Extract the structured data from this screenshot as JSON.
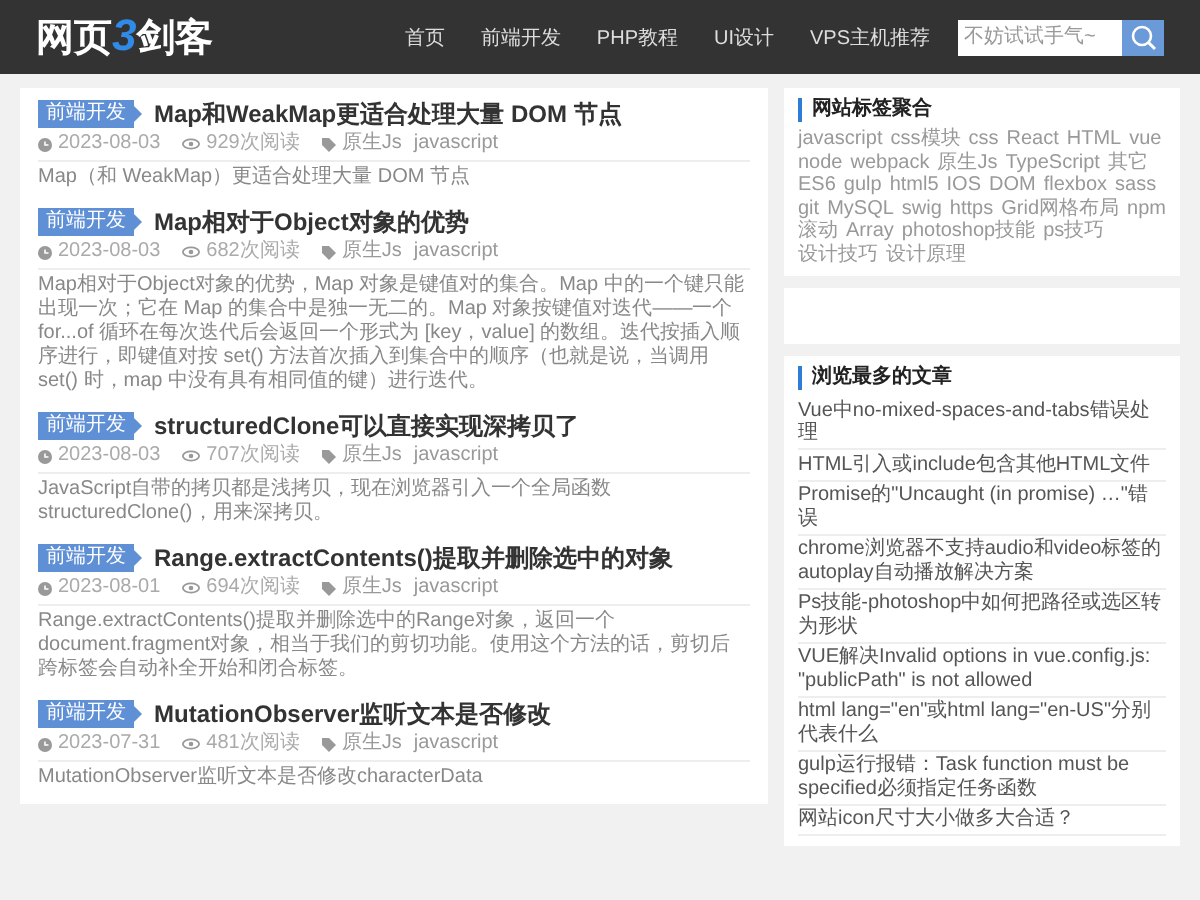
{
  "header": {
    "logo": {
      "text_before": "网页",
      "digit": "3",
      "text_after": "剑客"
    },
    "nav": [
      {
        "label": "首页"
      },
      {
        "label": "前端开发"
      },
      {
        "label": "PHP教程"
      },
      {
        "label": "UI设计"
      },
      {
        "label": "VPS主机推荐"
      }
    ],
    "search": {
      "placeholder": "不妨试试手气~"
    }
  },
  "articles": [
    {
      "category": "前端开发",
      "title": "Map和WeakMap更适合处理大量 DOM 节点",
      "date": "2023-08-03",
      "views": "929次阅读",
      "tags": [
        "原生Js",
        "javascript"
      ],
      "excerpt": "Map（和 WeakMap）更适合处理大量 DOM 节点"
    },
    {
      "category": "前端开发",
      "title": "Map相对于Object对象的优势",
      "date": "2023-08-03",
      "views": "682次阅读",
      "tags": [
        "原生Js",
        "javascript"
      ],
      "excerpt": "Map相对于Object对象的优势，Map 对象是键值对的集合。Map 中的一个键只能出现一次；它在 Map 的集合中是独一无二的。Map 对象按键值对迭代——一个 for...of 循环在每次迭代后会返回一个形式为 [key，value] 的数组。迭代按插入顺序进行，即键值对按 set() 方法首次插入到集合中的顺序（也就是说，当调用 set() 时，map 中没有具有相同值的键）进行迭代。"
    },
    {
      "category": "前端开发",
      "title": "structuredClone可以直接实现深拷贝了",
      "date": "2023-08-03",
      "views": "707次阅读",
      "tags": [
        "原生Js",
        "javascript"
      ],
      "excerpt": "JavaScript自带的拷贝都是浅拷贝，现在浏览器引入一个全局函数structuredClone()，用来深拷贝。"
    },
    {
      "category": "前端开发",
      "title": "Range.extractContents()提取并删除选中的对象",
      "date": "2023-08-01",
      "views": "694次阅读",
      "tags": [
        "原生Js",
        "javascript"
      ],
      "excerpt": "Range.extractContents()提取并删除选中的Range对象，返回一个document.fragment对象，相当于我们的剪切功能。使用这个方法的话，剪切后跨标签会自动补全开始和闭合标签。"
    },
    {
      "category": "前端开发",
      "title": "MutationObserver监听文本是否修改",
      "date": "2023-07-31",
      "views": "481次阅读",
      "tags": [
        "原生Js",
        "javascript"
      ],
      "excerpt": "MutationObserver监听文本是否修改characterData"
    }
  ],
  "sidebar": {
    "tag_cloud": {
      "title": "网站标签聚合",
      "tags": [
        "javascript",
        "css模块",
        "css",
        "React",
        "HTML",
        "vue",
        "node",
        "webpack",
        "原生Js",
        "TypeScript",
        "其它",
        "ES6",
        "gulp",
        "html5",
        "IOS",
        "DOM",
        "flexbox",
        "sass",
        "git",
        "MySQL",
        "swig",
        "https",
        "Grid网格布局",
        "npm",
        "滚动",
        "Array",
        "photoshop技能",
        "ps技巧",
        "设计技巧",
        "设计原理"
      ]
    },
    "popular": {
      "title": "浏览最多的文章",
      "items": [
        "Vue中no-mixed-spaces-and-tabs错误处理",
        "HTML引入或include包含其他HTML文件",
        "Promise的\"Uncaught (in promise) …\"错误",
        "chrome浏览器不支持audio和video标签的autoplay自动播放解决方案",
        "Ps技能-photoshop中如何把路径或选区转为形状",
        "VUE解决Invalid options in vue.config.js: \"publicPath\" is not allowed",
        "html lang=\"en\"或html lang=\"en-US\"分别代表什么",
        "gulp运行报错：Task function must be specified必须指定任务函数",
        "网站icon尺寸大小做多大合适？"
      ]
    }
  }
}
